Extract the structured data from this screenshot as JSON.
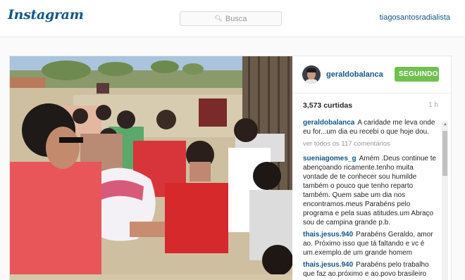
{
  "header": {
    "logo": "Instagram",
    "search_placeholder": "Busca",
    "current_user": "tiagosantosradialista"
  },
  "post": {
    "author": "geraldobalanca",
    "follow_label": "SEGUINDO",
    "likes": "3,573 curtidas",
    "time": "1 h",
    "caption_author": "geraldobalanca",
    "caption_text": "A caridade me leva onde eu for...um dia eu recebi o que hoje dou.",
    "view_all": "ver todos os 117 comentários",
    "comments": [
      {
        "author": "sueniagomes_g",
        "text": "Amém .Deus continue te abençoando ricamente.tenho muita vontade de te conhecer sou humilde também o pouco que tenho reparto também. Quem sabe um dia nos encontramos.meus Parabéns pelo programa e pela suas atitudes.um Abraço sou de campina grande p.b."
      },
      {
        "author": "thais.jesus.940",
        "text": "Parabéns Geraldo, amor ao. Próximo isso que tá faltando e vc é um.exemplo.de um grande homem"
      },
      {
        "author": "thais.jesus.940",
        "text": "Parabéns pelo trabalho que faz ao.próximo e ao.povo brasileiro"
      }
    ]
  },
  "colors": {
    "brand": "#125688",
    "follow_button": "#70c050"
  }
}
